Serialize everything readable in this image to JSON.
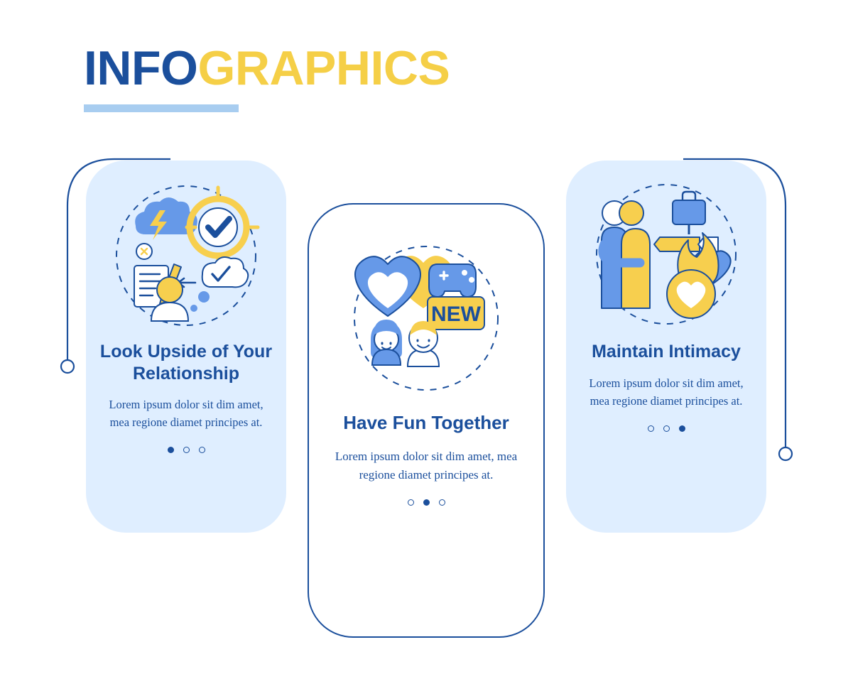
{
  "title": {
    "part1": "INFO",
    "part2": "GRAPHICS",
    "accent_blue": "#1b4f9c",
    "accent_yellow": "#f5cf47",
    "underline_color": "#a8cdf0"
  },
  "cards": [
    {
      "id": "card-1",
      "icon_name": "relationship-reflection-icon",
      "heading": "Look Upside of Your Relationship",
      "body": "Lorem ipsum dolor sit dim amet, mea regione diamet principes at.",
      "dots": [
        "filled",
        "hollow",
        "hollow"
      ]
    },
    {
      "id": "card-2",
      "icon_name": "fun-together-icon",
      "heading": "Have Fun Together",
      "body": "Lorem ipsum dolor sit dim amet, mea regione diamet principes at.",
      "dots": [
        "hollow",
        "filled",
        "hollow"
      ]
    },
    {
      "id": "card-3",
      "icon_name": "maintain-intimacy-icon",
      "heading": "Maintain Intimacy",
      "body": "Lorem ipsum dolor sit dim amet, mea regione diamet principes at.",
      "dots": [
        "hollow",
        "hollow",
        "filled"
      ]
    }
  ],
  "palette": {
    "card_background": "#dfeeff",
    "outline": "#1b4f9c",
    "icon_blue": "#6699e8",
    "icon_yellow": "#f7cf4e",
    "white": "#ffffff"
  }
}
